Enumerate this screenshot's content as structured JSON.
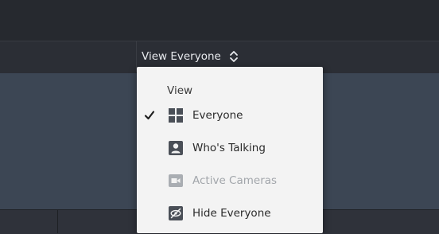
{
  "toolbar": {
    "view_selector_label": "View Everyone",
    "view_selector_icon": "up-down-chevron-icon"
  },
  "view_menu": {
    "header": "View",
    "items": [
      {
        "label": "Everyone",
        "icon": "grid-icon",
        "checked": true,
        "enabled": true
      },
      {
        "label": "Who's Talking",
        "icon": "person-icon",
        "checked": false,
        "enabled": true
      },
      {
        "label": "Active Cameras",
        "icon": "video-camera-icon",
        "checked": false,
        "enabled": false
      },
      {
        "label": "Hide Everyone",
        "icon": "eye-off-icon",
        "checked": false,
        "enabled": true
      }
    ]
  },
  "colors": {
    "dark_background": "#23262c",
    "video_area": "#3c4654",
    "menu_background": "#f3f3f3",
    "icon_dark": "#4a4f57",
    "disabled_text": "#a2a6ab"
  }
}
